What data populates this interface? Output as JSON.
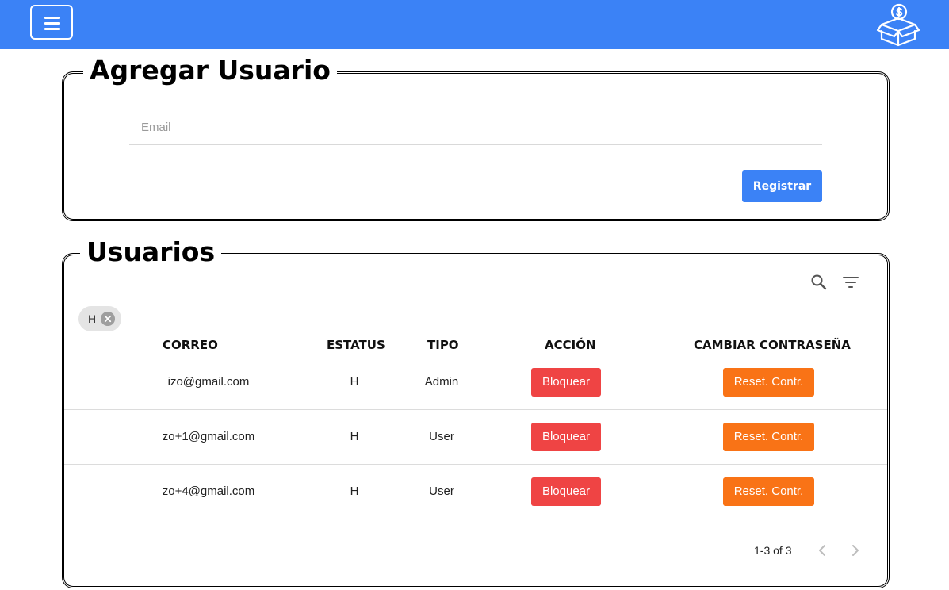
{
  "header": {
    "menu_icon": "hamburger-menu-icon",
    "logo_icon": "money-box-icon",
    "brand_color": "#3b82f6"
  },
  "add_user": {
    "title": "Agregar Usuario",
    "email_placeholder": "Email",
    "email_value": "",
    "register_label": "Registrar"
  },
  "users": {
    "title": "Usuarios",
    "toolbar_icons": [
      "search-icon",
      "filter-icon"
    ],
    "filter_chip": {
      "label": "H"
    },
    "columns": [
      "CORREO",
      "ESTATUS",
      "TIPO",
      "ACCIÓN",
      "CAMBIAR CONTRASEÑA"
    ],
    "rows": [
      {
        "correo": "izo@gmail.com",
        "estatus": "H",
        "tipo": "Admin",
        "accion": "Bloquear",
        "cambiar": "Reset. Contr."
      },
      {
        "correo": "zo+1@gmail.com",
        "estatus": "H",
        "tipo": "User",
        "accion": "Bloquear",
        "cambiar": "Reset. Contr."
      },
      {
        "correo": "zo+4@gmail.com",
        "estatus": "H",
        "tipo": "User",
        "accion": "Bloquear",
        "cambiar": "Reset. Contr."
      }
    ],
    "pagination": {
      "text": "1-3 of 3"
    },
    "colors": {
      "block_button": "#ef4444",
      "reset_button": "#f97316"
    }
  }
}
